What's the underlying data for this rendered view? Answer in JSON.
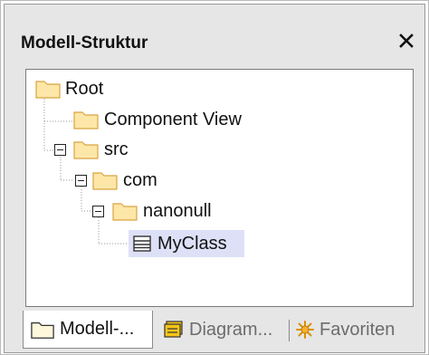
{
  "window": {
    "title": "Modell-Struktur",
    "close_glyph": "✕"
  },
  "tree": {
    "nodes": [
      {
        "label": "Root",
        "icon": "folder-icon"
      },
      {
        "label": "Component View",
        "icon": "folder-icon"
      },
      {
        "label": "src",
        "icon": "folder-icon",
        "expanded": true
      },
      {
        "label": "com",
        "icon": "folder-icon",
        "expanded": true
      },
      {
        "label": "nanonull",
        "icon": "folder-icon",
        "expanded": true
      },
      {
        "label": "MyClass",
        "icon": "class-icon",
        "selected": true
      }
    ]
  },
  "tabs": [
    {
      "label": "Modell-...",
      "icon": "folder-icon",
      "active": true
    },
    {
      "label": "Diagram...",
      "icon": "diagram-icon",
      "active": false
    },
    {
      "label": "Favoriten",
      "icon": "star-icon",
      "active": false
    }
  ],
  "colors": {
    "folder_fill": "#fde7a8",
    "folder_stroke": "#d9a441",
    "selection": "#dde0f6",
    "diagram_icon": "#e7b100",
    "star_icon": "#d99000"
  }
}
